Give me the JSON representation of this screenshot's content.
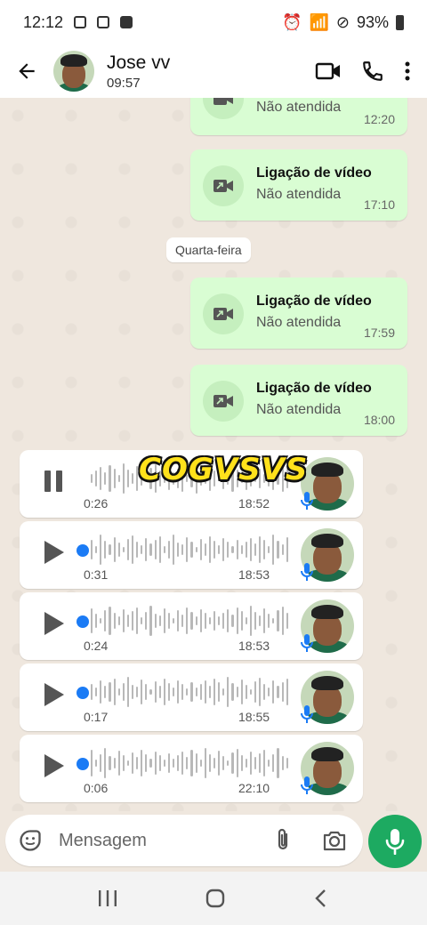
{
  "status_bar": {
    "time": "12:12",
    "battery": "93%"
  },
  "header": {
    "name": "Jose vv",
    "subtitle": "09:57"
  },
  "calls": [
    {
      "title": "",
      "status": "Não atendida",
      "time": "12:20"
    },
    {
      "title": "Ligação de vídeo",
      "status": "Não atendida",
      "time": "17:10"
    },
    {
      "title": "Ligação de vídeo",
      "status": "Não atendida",
      "time": "17:59"
    },
    {
      "title": "Ligação de vídeo",
      "status": "Não atendida",
      "time": "18:00"
    }
  ],
  "day_separator": "Quarta-feira",
  "sticker_text": "COGVSVS",
  "voice_messages": [
    {
      "duration": "0:26",
      "time": "18:52",
      "playing": true
    },
    {
      "duration": "0:31",
      "time": "18:53",
      "playing": false
    },
    {
      "duration": "0:24",
      "time": "18:53",
      "playing": false
    },
    {
      "duration": "0:17",
      "time": "18:55",
      "playing": false
    },
    {
      "duration": "0:06",
      "time": "22:10",
      "playing": false
    }
  ],
  "input": {
    "placeholder": "Mensagem"
  },
  "colors": {
    "outgoing_bubble": "#d9fdd3",
    "accent": "#1daa61",
    "progress_dot": "#1b7bf5"
  }
}
